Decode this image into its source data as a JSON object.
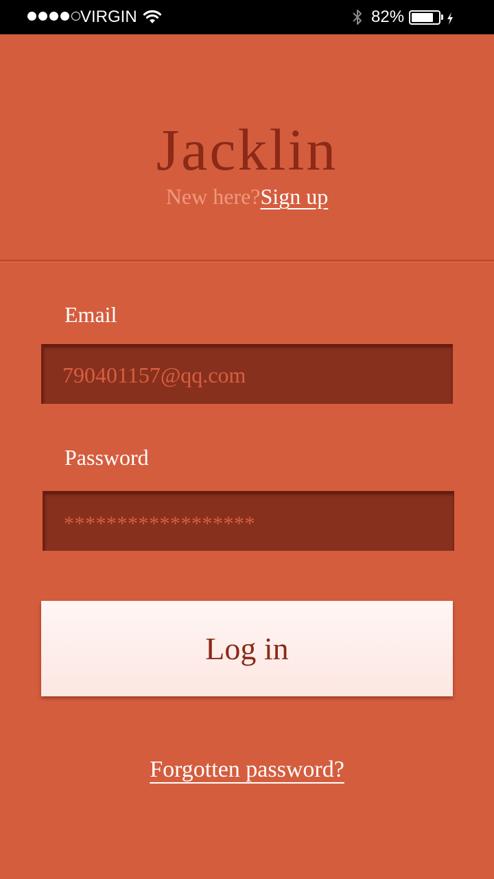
{
  "status_bar": {
    "carrier": "VIRGIN",
    "signal_bars_filled": 4,
    "signal_bars_total": 5,
    "battery_percent_label": "82%",
    "battery_level": 0.82,
    "icons": [
      "wifi-icon",
      "bluetooth-icon",
      "battery-icon",
      "charging-bolt-icon"
    ]
  },
  "header": {
    "app_title": "Jacklin",
    "new_here_text": "New here?",
    "signup_label": "Sign up"
  },
  "form": {
    "email": {
      "label": "Email",
      "value": "790401157@qq.com"
    },
    "password": {
      "label": "Password",
      "masked_value": "******************"
    },
    "login_label": "Log in",
    "forgot_label": "Forgotten password?"
  },
  "colors": {
    "background": "#d45d3e",
    "input_background": "#88301e",
    "title_text": "#8b2a17",
    "button_background": "#fff6f4",
    "link_text": "#ffffff",
    "muted_text": "#ee9a7e"
  }
}
